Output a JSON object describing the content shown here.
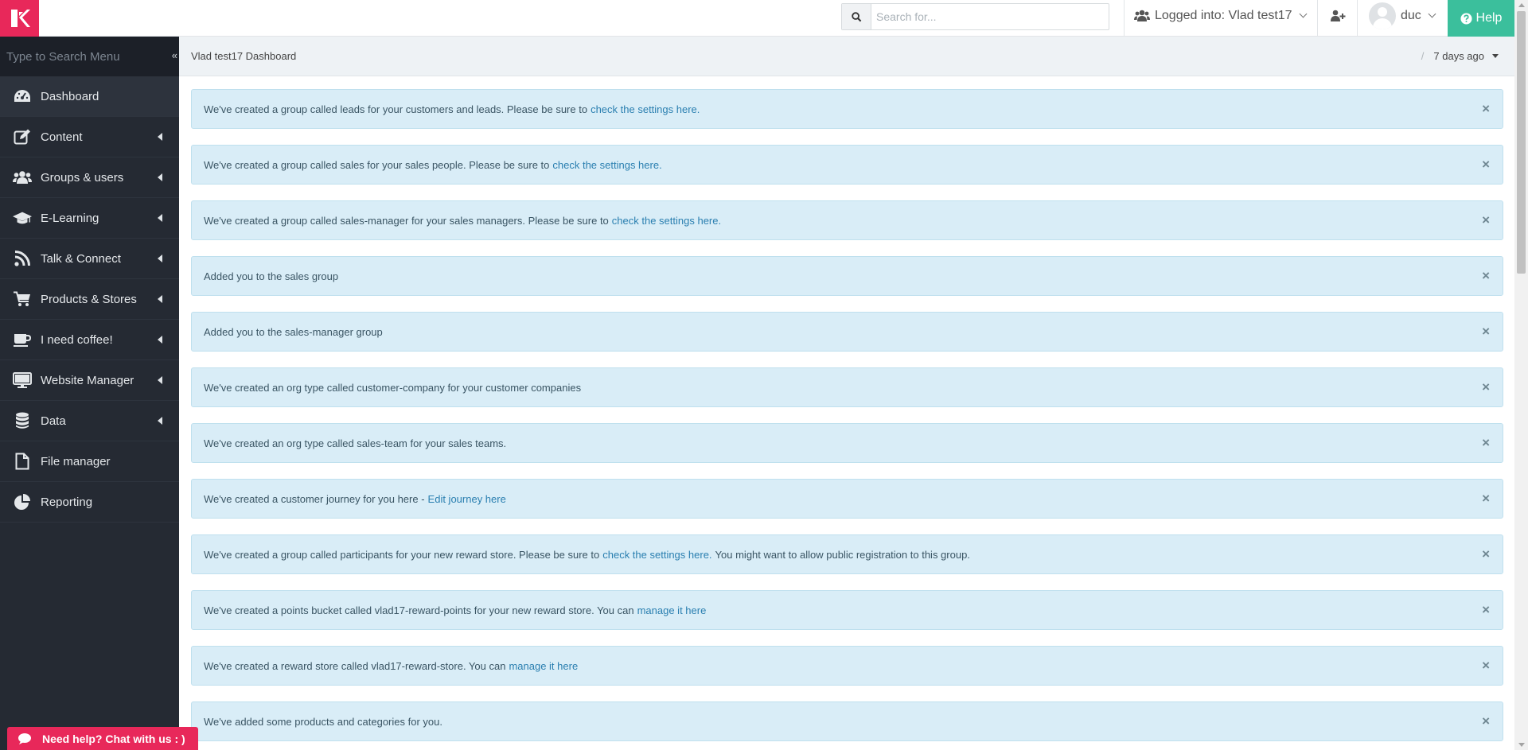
{
  "header": {
    "search_placeholder": "Search for...",
    "logged_label": "Logged into: Vlad test17",
    "user_name": "duc",
    "help_label": "Help"
  },
  "sidebar": {
    "search_placeholder": "Type to Search Menu",
    "items": [
      {
        "label": "Dashboard",
        "icon": "dashboard-icon",
        "has_submenu": false
      },
      {
        "label": "Content",
        "icon": "edit-icon",
        "has_submenu": true
      },
      {
        "label": "Groups & users",
        "icon": "users-icon",
        "has_submenu": true
      },
      {
        "label": "E-Learning",
        "icon": "graduation-cap-icon",
        "has_submenu": true
      },
      {
        "label": "Talk & Connect",
        "icon": "rss-icon",
        "has_submenu": true
      },
      {
        "label": "Products & Stores",
        "icon": "shopping-cart-icon",
        "has_submenu": true
      },
      {
        "label": "I need coffee!",
        "icon": "coffee-icon",
        "has_submenu": true
      },
      {
        "label": "Website Manager",
        "icon": "desktop-icon",
        "has_submenu": true
      },
      {
        "label": "Data",
        "icon": "database-icon",
        "has_submenu": true
      },
      {
        "label": "File manager",
        "icon": "file-icon",
        "has_submenu": false
      },
      {
        "label": "Reporting",
        "icon": "pie-chart-icon",
        "has_submenu": false
      }
    ]
  },
  "breadcrumb": "Vlad test17 Dashboard",
  "time_filter": "7 days ago",
  "alerts": [
    {
      "text": "We've created a group called leads for your customers and leads. Please be sure to",
      "link": "check the settings here.",
      "after": ""
    },
    {
      "text": "We've created a group called sales for your sales people. Please be sure to",
      "link": "check the settings here.",
      "after": ""
    },
    {
      "text": "We've created a group called sales-manager for your sales managers. Please be sure to",
      "link": "check the settings here.",
      "after": ""
    },
    {
      "text": "Added you to the sales group",
      "link": "",
      "after": ""
    },
    {
      "text": "Added you to the sales-manager group",
      "link": "",
      "after": ""
    },
    {
      "text": "We've created an org type called customer-company for your customer companies",
      "link": "",
      "after": ""
    },
    {
      "text": "We've created an org type called sales-team for your sales teams.",
      "link": "",
      "after": ""
    },
    {
      "text": "We've created a customer journey for you here -",
      "link": "Edit journey here",
      "after": ""
    },
    {
      "text": "We've created a group called participants for your new reward store. Please be sure to",
      "link": "check the settings here.",
      "after": "You might want to allow public registration to this group."
    },
    {
      "text": "We've created a points bucket called vlad17-reward-points for your new reward store. You can",
      "link": "manage it here",
      "after": ""
    },
    {
      "text": "We've created a reward store called vlad17-reward-store. You can",
      "link": "manage it here",
      "after": ""
    },
    {
      "text": "We've added some products and categories for you.",
      "link": "",
      "after": ""
    }
  ],
  "close_symbol": "×",
  "chat_label": "Need help? Chat with us : )",
  "colors": {
    "brand": "#e8285a",
    "help": "#3bbf9c",
    "sidebar": "#252a33",
    "alert_bg": "#d9edf7",
    "link": "#2a7fb0"
  }
}
